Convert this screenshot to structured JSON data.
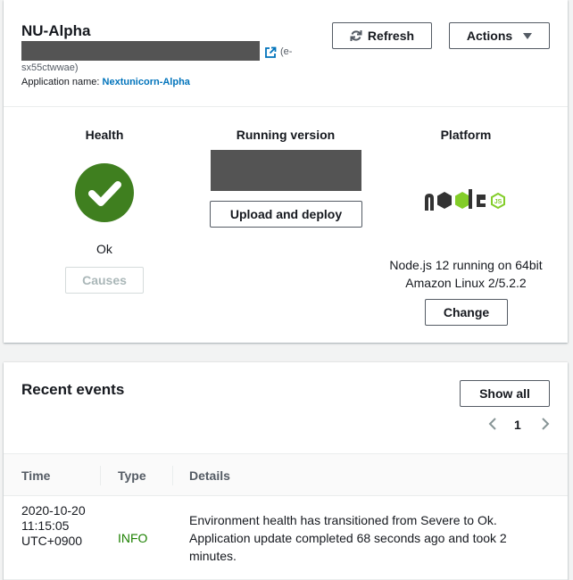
{
  "environment": {
    "name": "NU-Alpha",
    "id_part1": "(e-",
    "id_part2": "sx55ctwwae)",
    "app_name_label": "Application name:",
    "app_name": "Nextunicorn-Alpha",
    "refresh_label": "Refresh",
    "actions_label": "Actions"
  },
  "health": {
    "title": "Health",
    "status": "Ok",
    "causes_label": "Causes",
    "color": "#3f7f1f"
  },
  "running_version": {
    "title": "Running version",
    "upload_label": "Upload and deploy"
  },
  "platform": {
    "title": "Platform",
    "description": "Node.js 12 running on 64bit Amazon Linux 2/5.2.2",
    "change_label": "Change",
    "logo_icon": "nodejs-logo"
  },
  "events": {
    "title": "Recent events",
    "show_all_label": "Show all",
    "page": "1",
    "columns": {
      "time": "Time",
      "type": "Type",
      "details": "Details"
    },
    "rows": [
      {
        "time": "2020-10-20 11:15:05 UTC+0900",
        "type": "INFO",
        "details": "Environment health has transitioned from Severe to Ok. Application update completed 68 seconds ago and took 2 minutes."
      }
    ]
  }
}
